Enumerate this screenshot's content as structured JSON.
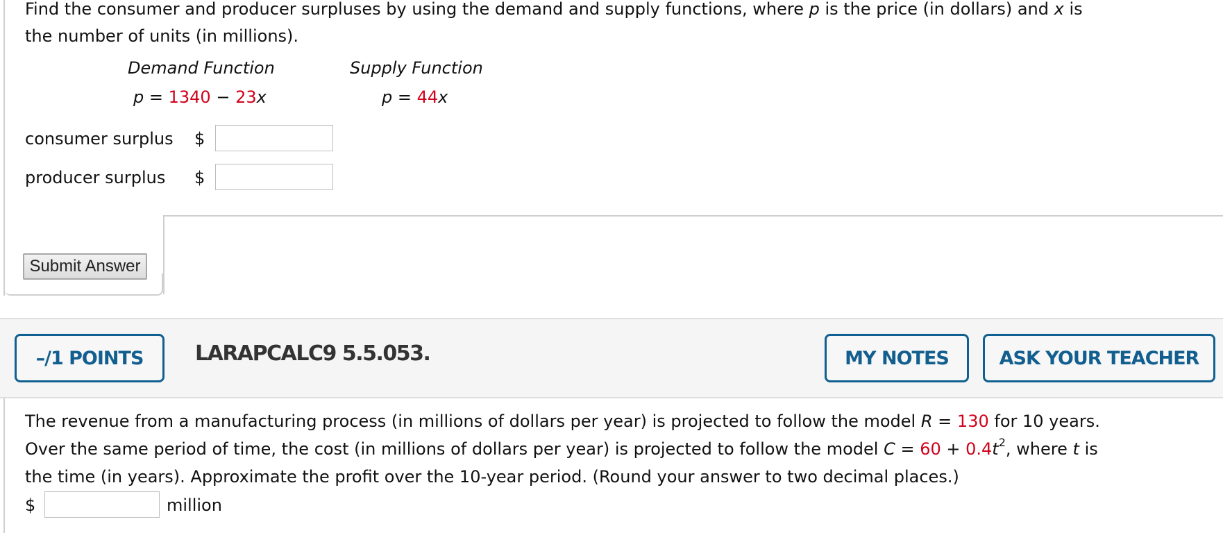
{
  "question1": {
    "intro_part1": "Find the consumer and producer surpluses by using the demand and supply functions, where ",
    "var_p": "p",
    "intro_part2": " is the price (in dollars) and ",
    "var_x": "x",
    "intro_part3": " is",
    "intro_line2": "the number of units (in millions).",
    "demand": {
      "title": "Demand Function",
      "lhs": "p",
      "eq": " = ",
      "constant": "1340",
      "minus": " − ",
      "coef": "23",
      "var": "x"
    },
    "supply": {
      "title": "Supply Function",
      "lhs": "p",
      "eq": " = ",
      "coef": "44",
      "var": "x"
    },
    "fields": [
      {
        "label": "consumer surplus",
        "currency": "$",
        "value": ""
      },
      {
        "label": "producer surplus",
        "currency": "$",
        "value": ""
      }
    ],
    "submit_label": "Submit Answer"
  },
  "question2": {
    "points_label": "–/1 POINTS",
    "title": "LARAPCALC9 5.5.053.",
    "my_notes_label": "MY NOTES",
    "ask_teacher_label": "ASK YOUR TEACHER",
    "text": {
      "s1": "The revenue from a manufacturing process (in millions of dollars per year) is projected to follow the model ",
      "R": "R",
      "eq1": " = ",
      "r_val": "130",
      "s2": " for 10 years.",
      "s3": "Over the same period of time, the cost (in millions of dollars per year) is projected to follow the model ",
      "C": "C",
      "eq2": " = ",
      "c_const": "60",
      "plus": " + ",
      "c_coef": "0.4",
      "t": "t",
      "exp": "2",
      "s4": ", where ",
      "t2": "t",
      "s5": " is",
      "s6": "the time (in years). Approximate the profit over the 10-year period. (Round your answer to two decimal places.)"
    },
    "answer": {
      "currency": "$",
      "value": "",
      "unit": "million"
    }
  },
  "colors": {
    "accent_blue": "#0f6090",
    "given_value_red": "#d0021b",
    "header_bg": "#f5f5f5"
  }
}
